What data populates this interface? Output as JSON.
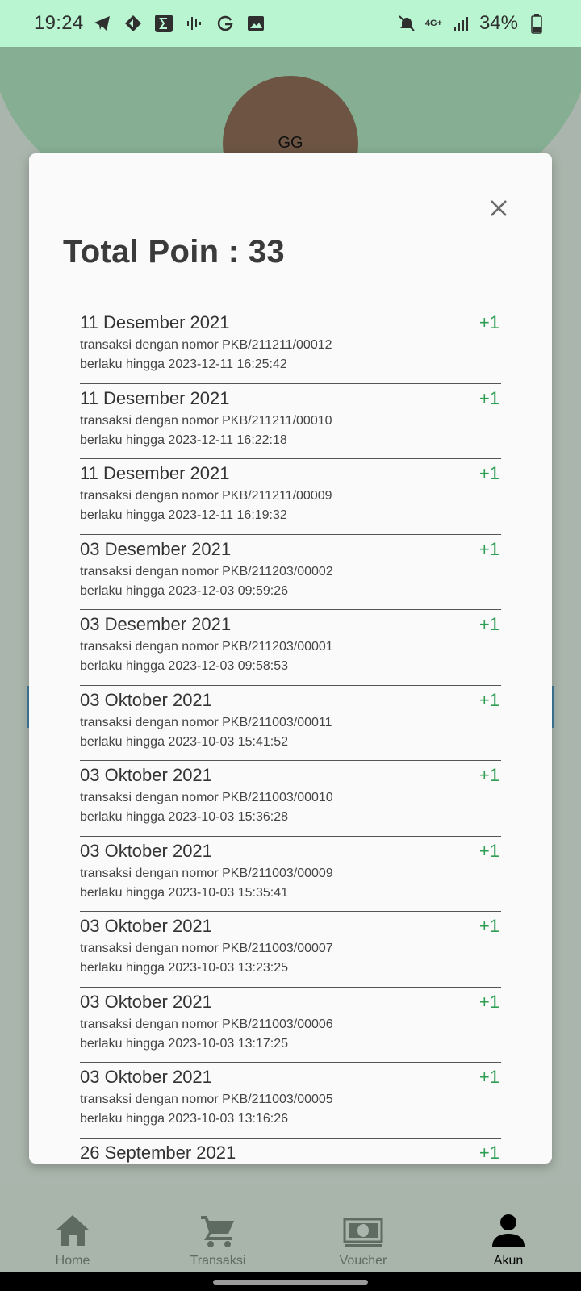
{
  "status_bar": {
    "time": "19:24",
    "left_icons": [
      "telegram-icon",
      "diamond-arrows-icon",
      "sigma-icon",
      "sound-wave-icon",
      "g-icon",
      "image-icon"
    ],
    "battery": "34%",
    "network": "4G+"
  },
  "profile": {
    "avatar_initials": "GG"
  },
  "dialog": {
    "title": "Total Poin : 33",
    "items": [
      {
        "date": "11 Desember 2021",
        "desc": "transaksi dengan nomor PKB/211211/00012",
        "expiry": "berlaku hingga 2023-12-11 16:25:42",
        "points": "+1"
      },
      {
        "date": "11 Desember 2021",
        "desc": "transaksi dengan nomor PKB/211211/00010",
        "expiry": "berlaku hingga 2023-12-11 16:22:18",
        "points": "+1"
      },
      {
        "date": "11 Desember 2021",
        "desc": "transaksi dengan nomor PKB/211211/00009",
        "expiry": "berlaku hingga 2023-12-11 16:19:32",
        "points": "+1"
      },
      {
        "date": "03 Desember 2021",
        "desc": "transaksi dengan nomor PKB/211203/00002",
        "expiry": "berlaku hingga 2023-12-03 09:59:26",
        "points": "+1"
      },
      {
        "date": "03 Desember 2021",
        "desc": "transaksi dengan nomor PKB/211203/00001",
        "expiry": "berlaku hingga 2023-12-03 09:58:53",
        "points": "+1"
      },
      {
        "date": "03 Oktober 2021",
        "desc": "transaksi dengan nomor PKB/211003/00011",
        "expiry": "berlaku hingga 2023-10-03 15:41:52",
        "points": "+1"
      },
      {
        "date": "03 Oktober 2021",
        "desc": "transaksi dengan nomor PKB/211003/00010",
        "expiry": "berlaku hingga 2023-10-03 15:36:28",
        "points": "+1"
      },
      {
        "date": "03 Oktober 2021",
        "desc": "transaksi dengan nomor PKB/211003/00009",
        "expiry": "berlaku hingga 2023-10-03 15:35:41",
        "points": "+1"
      },
      {
        "date": "03 Oktober 2021",
        "desc": "transaksi dengan nomor PKB/211003/00007",
        "expiry": "berlaku hingga 2023-10-03 13:23:25",
        "points": "+1"
      },
      {
        "date": "03 Oktober 2021",
        "desc": "transaksi dengan nomor PKB/211003/00006",
        "expiry": "berlaku hingga 2023-10-03 13:17:25",
        "points": "+1"
      },
      {
        "date": "03 Oktober 2021",
        "desc": "transaksi dengan nomor PKB/211003/00005",
        "expiry": "berlaku hingga 2023-10-03 13:16:26",
        "points": "+1"
      },
      {
        "date": "26 September 2021",
        "desc": "",
        "expiry": "",
        "points": "+1"
      }
    ]
  },
  "bottom_nav": {
    "items": [
      {
        "label": "Home",
        "icon": "home-icon"
      },
      {
        "label": "Transaksi",
        "icon": "cart-icon"
      },
      {
        "label": "Voucher",
        "icon": "money-icon"
      },
      {
        "label": "Akun",
        "icon": "person-icon"
      }
    ],
    "active": "Akun"
  },
  "colors": {
    "status_bar_bg": "#b8f5d0",
    "header_arc": "#86ae93",
    "avatar_bg": "#6d5443",
    "points_green": "#2e9e53",
    "nav_inactive": "#5e6b61"
  }
}
